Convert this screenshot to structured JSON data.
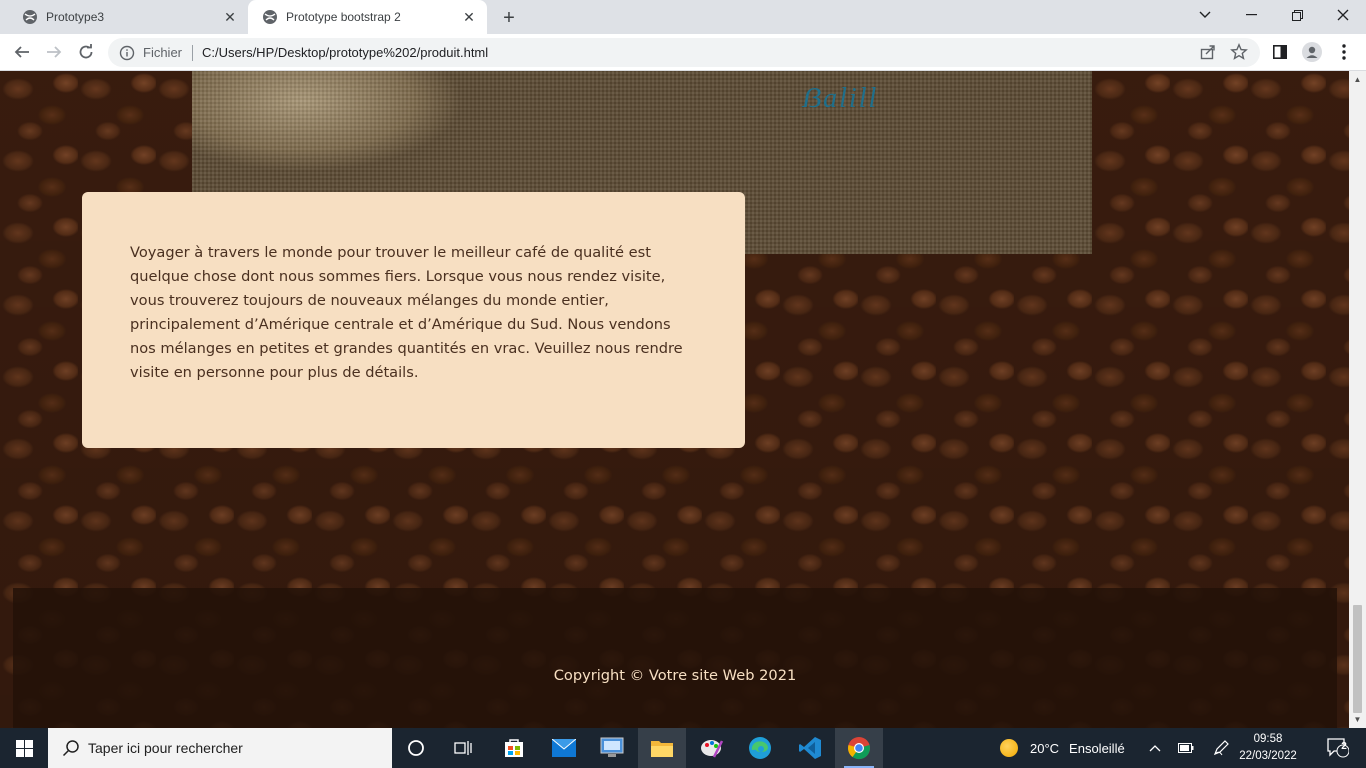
{
  "browser": {
    "tabs": [
      {
        "title": "Prototype3",
        "active": false
      },
      {
        "title": "Prototype bootstrap 2",
        "active": true
      }
    ],
    "address": {
      "scheme_label": "Fichier",
      "url": "C:/Users/HP/Desktop/prototype%202/produit.html"
    },
    "icons": {
      "back": "back-arrow-icon",
      "forward": "forward-arrow-icon",
      "reload": "reload-icon",
      "info": "info-icon",
      "share": "share-icon",
      "bookmark": "star-icon",
      "sidepanel": "side-panel-icon",
      "profile": "profile-icon",
      "menu": "kebab-menu-icon"
    }
  },
  "page": {
    "sack_label": "ẞalill",
    "card_text": "Voyager à travers le monde pour trouver le meilleur café de qualité est quelque chose dont nous sommes fiers. Lorsque vous nous rendez visite, vous trouverez toujours de nouveaux mélanges du monde entier, principalement d’Amérique centrale et d’Amérique du Sud. Nous vendons nos mélanges en petites et grandes quantités en vrac. Veuillez nous rendre visite en personne pour plus de détails.",
    "footer_text": "Copyright © Votre site Web 2021",
    "colors": {
      "card_bg": "#f7dfc2",
      "card_text": "#4a3020",
      "footer_bg": "#231108",
      "footer_text": "#f7dfc2"
    }
  },
  "taskbar": {
    "search_placeholder": "Taper ici pour rechercher",
    "apps": [
      "task-view-icon",
      "widgets-icon",
      "store-icon",
      "mail-icon",
      "remote-desktop-icon",
      "file-explorer-icon",
      "paint-icon",
      "edge-icon",
      "vscode-icon",
      "chrome-icon"
    ],
    "weather": {
      "temp": "20°C",
      "condition": "Ensoleillé"
    },
    "time": "09:58",
    "date": "22/03/2022",
    "notifications": "2"
  }
}
